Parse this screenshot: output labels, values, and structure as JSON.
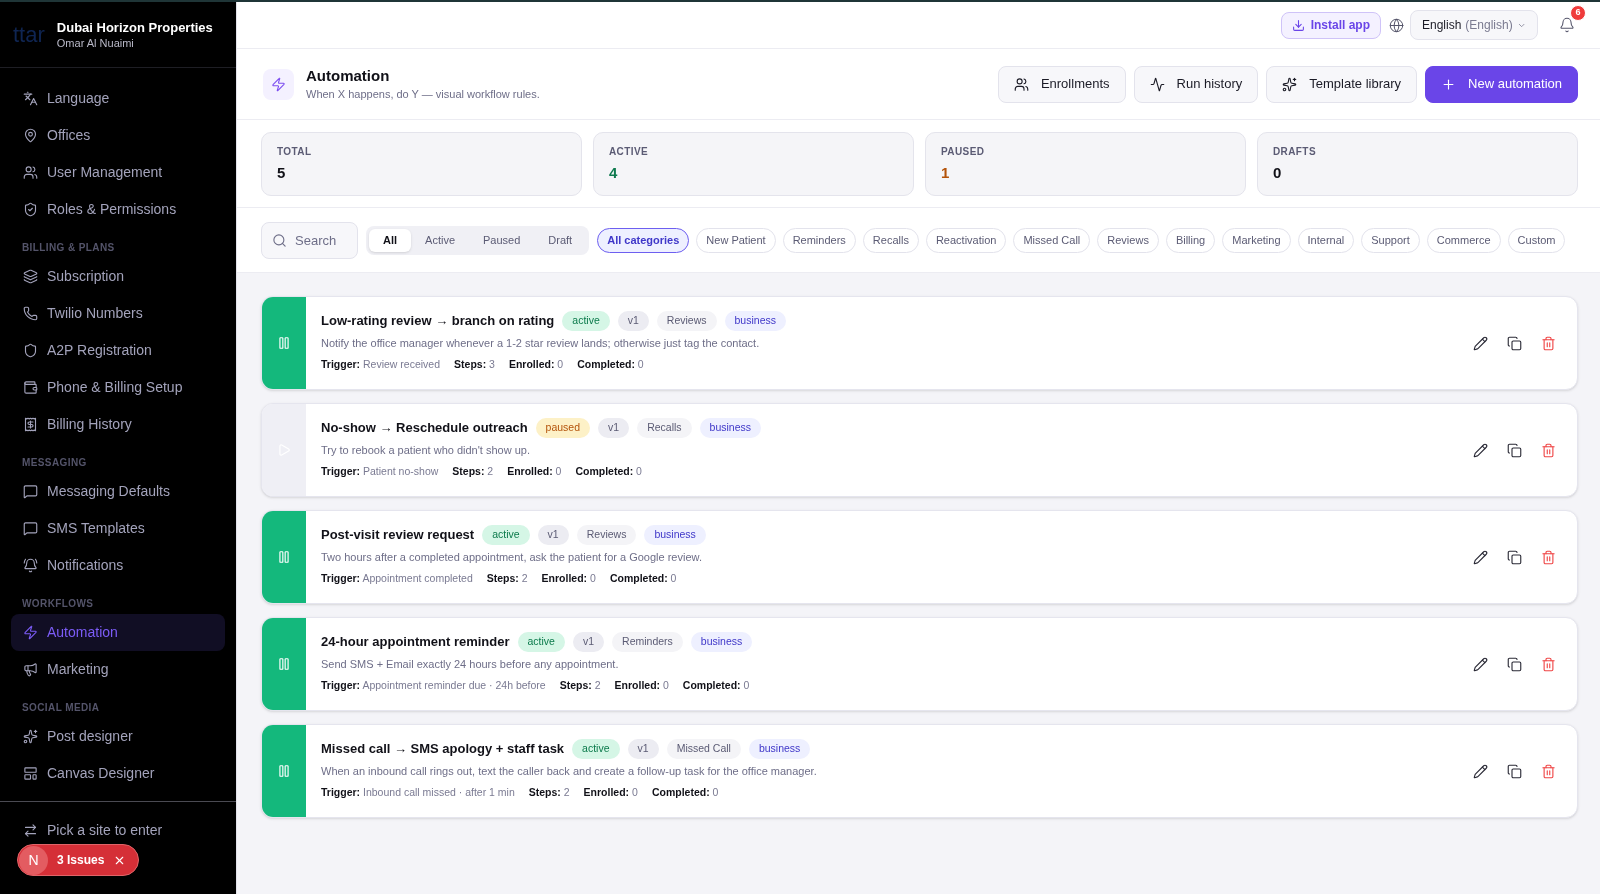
{
  "sidebar": {
    "logo": "ttar",
    "org": "Dubai Horizon Properties",
    "user": "Omar Al Nuaimi",
    "sections": [
      {
        "items": [
          {
            "label": "Language",
            "selected": false
          },
          {
            "label": "Offices",
            "selected": false
          },
          {
            "label": "User Management",
            "selected": false
          },
          {
            "label": "Roles & Permissions",
            "selected": false
          }
        ]
      },
      {
        "title": "BILLING & PLANS",
        "items": [
          {
            "label": "Subscription",
            "selected": false
          },
          {
            "label": "Twilio Numbers",
            "selected": false
          },
          {
            "label": "A2P Registration",
            "selected": false
          },
          {
            "label": "Phone & Billing Setup",
            "selected": false
          },
          {
            "label": "Billing History",
            "selected": false
          }
        ]
      },
      {
        "title": "MESSAGING",
        "items": [
          {
            "label": "Messaging Defaults",
            "selected": false
          },
          {
            "label": "SMS Templates",
            "selected": false
          },
          {
            "label": "Notifications",
            "selected": false
          }
        ]
      },
      {
        "title": "WORKFLOWS",
        "items": [
          {
            "label": "Automation",
            "selected": true
          },
          {
            "label": "Marketing",
            "selected": false
          }
        ]
      },
      {
        "title": "SOCIAL MEDIA",
        "items": [
          {
            "label": "Post designer",
            "selected": false
          },
          {
            "label": "Canvas Designer",
            "selected": false
          }
        ]
      }
    ],
    "site_picker": "Pick a site to enter",
    "issues": {
      "avatar": "N",
      "label": "3 Issues"
    }
  },
  "topbar": {
    "install_button": "Install app",
    "language": {
      "value": "English",
      "native": "(English)"
    },
    "notifications": "6"
  },
  "header": {
    "title": "Automation",
    "subtitle": "When X happens, do Y — visual workflow rules.",
    "buttons": [
      {
        "label": "Enrollments",
        "kind": "secondary"
      },
      {
        "label": "Run history",
        "kind": "secondary"
      },
      {
        "label": "Template library",
        "kind": "secondary"
      },
      {
        "label": "New automation",
        "kind": "primary"
      }
    ]
  },
  "stats": [
    {
      "label": "TOTAL",
      "value": "5",
      "color": "#111118"
    },
    {
      "label": "ACTIVE",
      "value": "4",
      "color": "#0f7a4f"
    },
    {
      "label": "PAUSED",
      "value": "1",
      "color": "#b4530a"
    },
    {
      "label": "DRAFTS",
      "value": "0",
      "color": "#111118"
    }
  ],
  "filters": {
    "search": {
      "placeholder": "Search"
    },
    "status_tabs": [
      {
        "label": "All",
        "selected": true
      },
      {
        "label": "Active",
        "selected": false
      },
      {
        "label": "Paused",
        "selected": false
      },
      {
        "label": "Draft",
        "selected": false
      }
    ],
    "categories": [
      {
        "label": "All categories",
        "selected": true
      },
      {
        "label": "New Patient",
        "selected": false
      },
      {
        "label": "Reminders",
        "selected": false
      },
      {
        "label": "Recalls",
        "selected": false
      },
      {
        "label": "Reactivation",
        "selected": false
      },
      {
        "label": "Missed Call",
        "selected": false
      },
      {
        "label": "Reviews",
        "selected": false
      },
      {
        "label": "Billing",
        "selected": false
      },
      {
        "label": "Marketing",
        "selected": false
      },
      {
        "label": "Internal",
        "selected": false
      },
      {
        "label": "Support",
        "selected": false
      },
      {
        "label": "Commerce",
        "selected": false
      },
      {
        "label": "Custom",
        "selected": false
      }
    ]
  },
  "automations": [
    {
      "kind": "active",
      "title": "Low-rating review → branch on rating",
      "status": "active",
      "version": "v1",
      "category": "Reviews",
      "scope": "business",
      "description": "Notify the office manager whenever a 1-2 star review lands; otherwise just tag the contact.",
      "meta": [
        "**Trigger:** Review received",
        "**Steps:** 3",
        "**Enrolled:** 0",
        "**Completed:** 0"
      ]
    },
    {
      "kind": "paused",
      "title": "No-show → Reschedule outreach",
      "status": "paused",
      "version": "v1",
      "category": "Recalls",
      "scope": "business",
      "description": "Try to rebook a patient who didn't show up.",
      "meta": [
        "**Trigger:** Patient no-show",
        "**Steps:** 2",
        "**Enrolled:** 0",
        "**Completed:** 0"
      ]
    },
    {
      "kind": "active",
      "title": "Post-visit review request",
      "status": "active",
      "version": "v1",
      "category": "Reviews",
      "scope": "business",
      "description": "Two hours after a completed appointment, ask the patient for a Google review.",
      "meta": [
        "**Trigger:** Appointment completed",
        "**Steps:** 2",
        "**Enrolled:** 0",
        "**Completed:** 0"
      ]
    },
    {
      "kind": "active",
      "title": "24-hour appointment reminder",
      "status": "active",
      "version": "v1",
      "category": "Reminders",
      "scope": "business",
      "description": "Send SMS + Email exactly 24 hours before any appointment.",
      "meta": [
        "**Trigger:** Appointment reminder due · 24h before",
        "**Steps:** 2",
        "**Enrolled:** 0",
        "**Completed:** 0"
      ]
    },
    {
      "kind": "active",
      "title": "Missed call → SMS apology + staff task",
      "status": "active",
      "version": "v1",
      "category": "Missed Call",
      "scope": "business",
      "description": "When an inbound call rings out, text the caller back and create a follow-up task for the office manager.",
      "meta": [
        "**Trigger:** Inbound call missed · after 1 min",
        "**Steps:** 2",
        "**Enrolled:** 0",
        "**Completed:** 0"
      ]
    }
  ]
}
